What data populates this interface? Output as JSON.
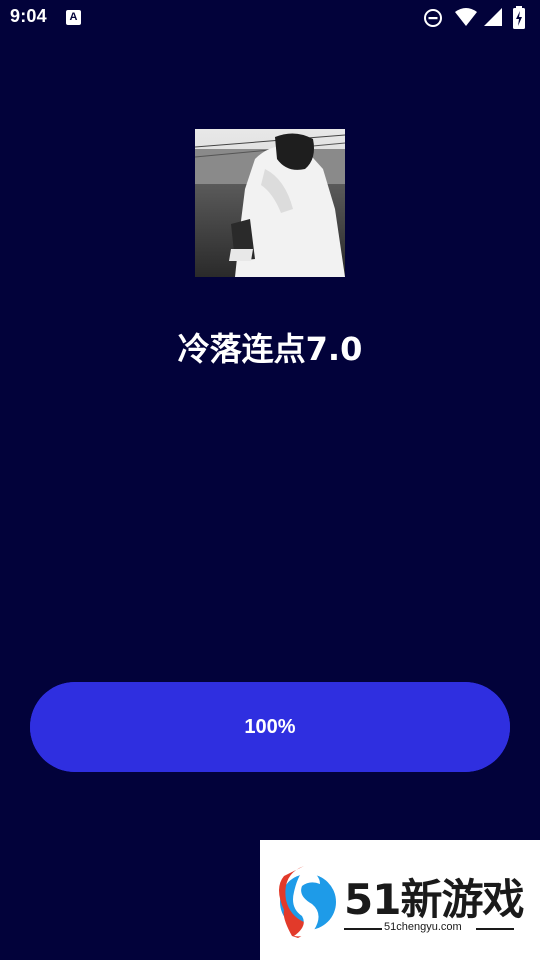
{
  "status_bar": {
    "time": "9:04",
    "notification_icon": "a-icon",
    "icons": [
      "do-not-disturb-icon",
      "wifi-icon",
      "cellular-signal-icon",
      "battery-charging-icon"
    ]
  },
  "app": {
    "image_icon": "person-photo",
    "title": "冷落连点7.0"
  },
  "progress": {
    "label": "100%",
    "value": 1.0,
    "color": "#2f2fe0"
  },
  "watermark": {
    "logo_icon": "51-logo-icon",
    "main_text": "51新游戏",
    "sub_text": "51chengyu.com"
  },
  "colors": {
    "background": "#02023a",
    "button": "#2f2fe0",
    "text": "#ffffff"
  }
}
